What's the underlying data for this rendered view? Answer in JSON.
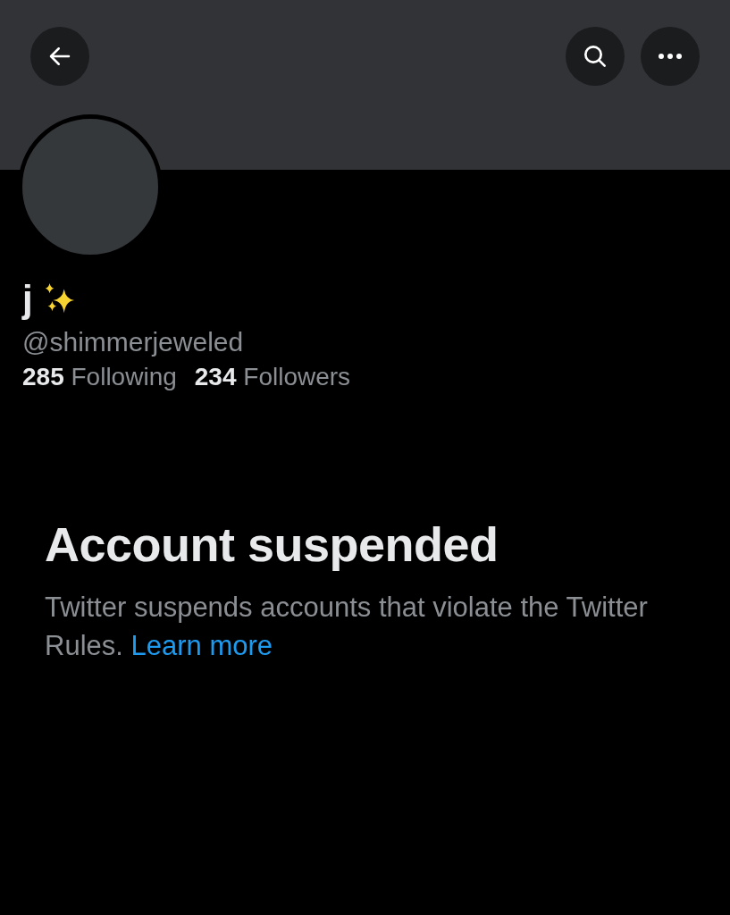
{
  "profile": {
    "name": "j",
    "handle": "@shimmerjeweled",
    "stats": [
      {
        "text": "**285** Following"
      },
      {
        "text": "**234** Followers"
      }
    ]
  },
  "notice": {
    "title": "Account suspended",
    "body": "Twitter suspends accounts that violate the Twitter Rules.",
    "link": "Learn more"
  }
}
